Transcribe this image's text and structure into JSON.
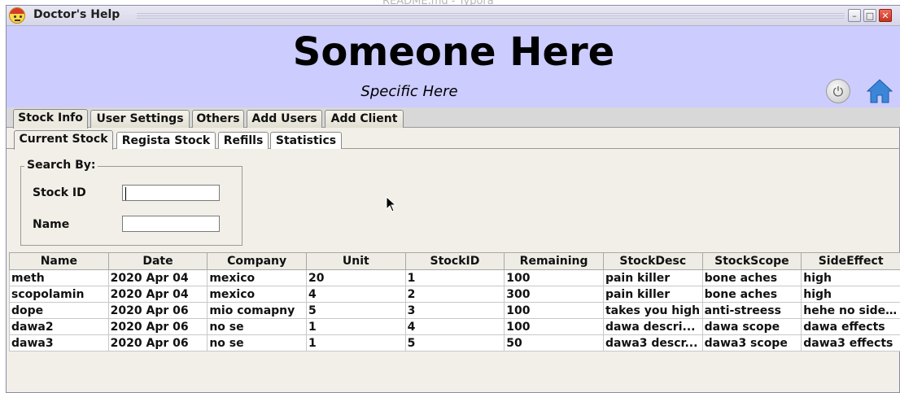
{
  "background": {
    "window_title": "README.md - Typora"
  },
  "window": {
    "title": "Doctor's Help",
    "controls": [
      "minimize",
      "maximize",
      "close"
    ]
  },
  "header": {
    "title": "Someone Here",
    "subtitle": "Specific Here",
    "power_icon": "power-icon",
    "home_icon": "home-icon",
    "bg_color": "#ccccff"
  },
  "main_tabs": [
    {
      "label": "Stock Info",
      "selected": true
    },
    {
      "label": "User Settings"
    },
    {
      "label": "Others"
    },
    {
      "label": "Add Users"
    },
    {
      "label": "Add Client"
    }
  ],
  "sub_tabs": [
    {
      "label": "Current Stock",
      "selected": true
    },
    {
      "label": "Regista Stock"
    },
    {
      "label": "Refills"
    },
    {
      "label": "Statistics"
    }
  ],
  "search": {
    "legend": "Search By:",
    "stock_id_label": "Stock ID",
    "stock_id_value": "",
    "name_label": "Name",
    "name_value": ""
  },
  "table": {
    "columns": [
      "Name",
      "Date",
      "Company",
      "Unit",
      "StockID",
      "Remaining",
      "StockDesc",
      "StockScope",
      "SideEffect"
    ],
    "rows": [
      [
        "meth",
        "2020 Apr 04",
        "mexico",
        "20",
        "1",
        "100",
        "pain killer",
        "bone aches",
        "high"
      ],
      [
        "scopolamin",
        "2020 Apr 04",
        "mexico",
        "4",
        "2",
        "300",
        "pain killer",
        "bone aches",
        "high"
      ],
      [
        "dope",
        "2020 Apr 06",
        "mio comapny",
        "5",
        "3",
        "100",
        "takes you high",
        "anti-streess",
        "hehe no side..."
      ],
      [
        "dawa2",
        "2020 Apr 06",
        "no se",
        "1",
        "4",
        "100",
        "dawa descri...",
        "dawa scope",
        "dawa effects"
      ],
      [
        "dawa3",
        "2020 Apr 06",
        "no se",
        "1",
        "5",
        "50",
        "dawa3 descr...",
        "dawa3 scope",
        "dawa3 effects"
      ]
    ]
  }
}
